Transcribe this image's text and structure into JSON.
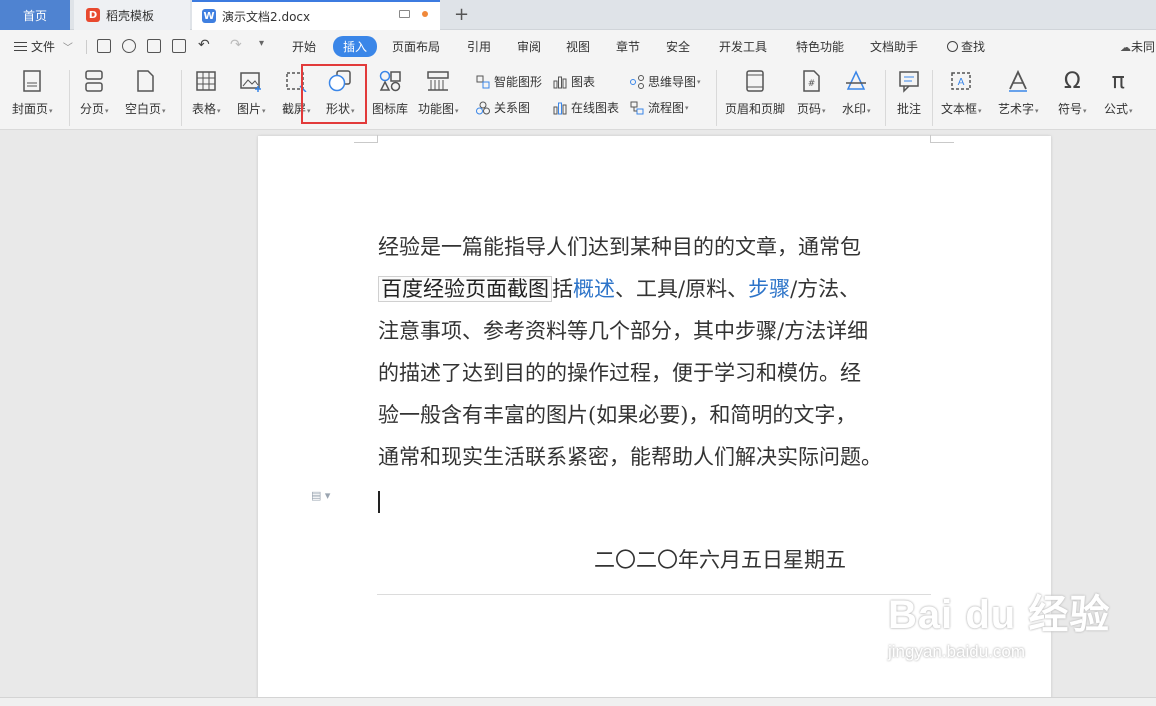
{
  "tabs": {
    "home": "首页",
    "template": "稻壳模板",
    "document": "演示文档2.docx",
    "template_icon_letter": "D",
    "document_icon_letter": "W",
    "new_tab": "+"
  },
  "menu": {
    "file": "文件",
    "items": [
      "开始",
      "插入",
      "页面布局",
      "引用",
      "审阅",
      "视图",
      "章节",
      "安全",
      "开发工具",
      "特色功能",
      "文档助手"
    ],
    "active": "插入",
    "search": "查找",
    "user": "未同"
  },
  "ribbon": {
    "cover": "封面页",
    "page_break": "分页",
    "blank_page": "空白页",
    "table": "表格",
    "picture": "图片",
    "screenshot": "截屏",
    "shape": "形状",
    "icon_lib": "图标库",
    "func_chart": "功能图",
    "smart_shape": "智能图形",
    "relation_chart": "关系图",
    "chart": "图表",
    "online_chart": "在线图表",
    "mind_map": "思维导图",
    "flow_chart": "流程图",
    "header_footer": "页眉和页脚",
    "page_number": "页码",
    "watermark": "水印",
    "comment": "批注",
    "textbox": "文本框",
    "wordart": "艺术字",
    "symbol": "符号",
    "formula": "公式"
  },
  "document": {
    "line1": "经验是一篇能指导人们达到某种目的的文章，通常包",
    "line2_boxed": "百度经验页面截图",
    "line2_a": "括",
    "line2_link1": "概述",
    "line2_b": "、工具/原料、",
    "line2_link2": "步骤",
    "line2_c": "/方法、",
    "line3": "注意事项、参考资料等几个部分，其中步骤/方法详细",
    "line4": "的描述了达到目的的操作过程，便于学习和模仿。经",
    "line5": "验一般含有丰富的图片(如果必要)，和简明的文字，",
    "line6": "通常和现实生活联系紧密，能帮助人们解决实际问题。",
    "date": "二〇二〇年六月五日星期五"
  },
  "watermark": {
    "brand": "Bai du 经验",
    "url": "jingyan.baidu.com"
  },
  "colors": {
    "accent": "#3a86e8",
    "highlight": "#e23a3a",
    "link": "#2d74c9"
  }
}
